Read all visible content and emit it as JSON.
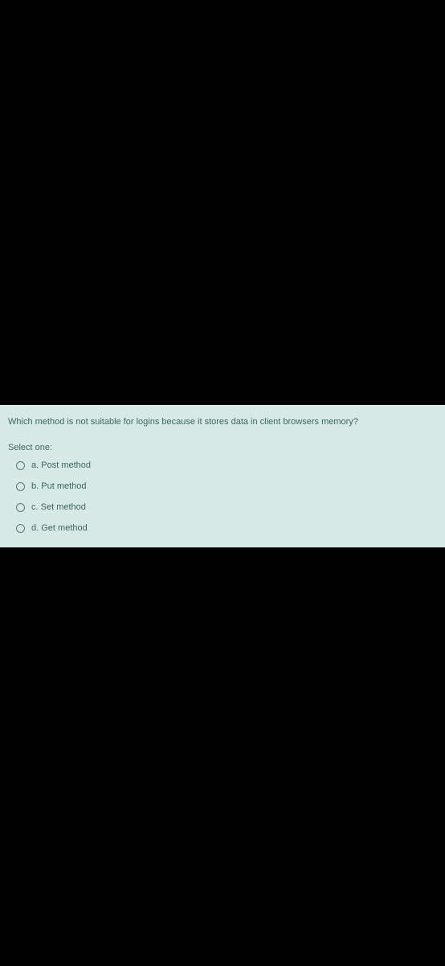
{
  "quiz": {
    "question": "Which method is not suitable for logins because it stores data in client browsers memory?",
    "select_label": "Select one:",
    "options": [
      {
        "letter": "a",
        "text": "Post method"
      },
      {
        "letter": "b",
        "text": "Put method"
      },
      {
        "letter": "c",
        "text": "Set method"
      },
      {
        "letter": "d",
        "text": "Get method"
      }
    ]
  }
}
